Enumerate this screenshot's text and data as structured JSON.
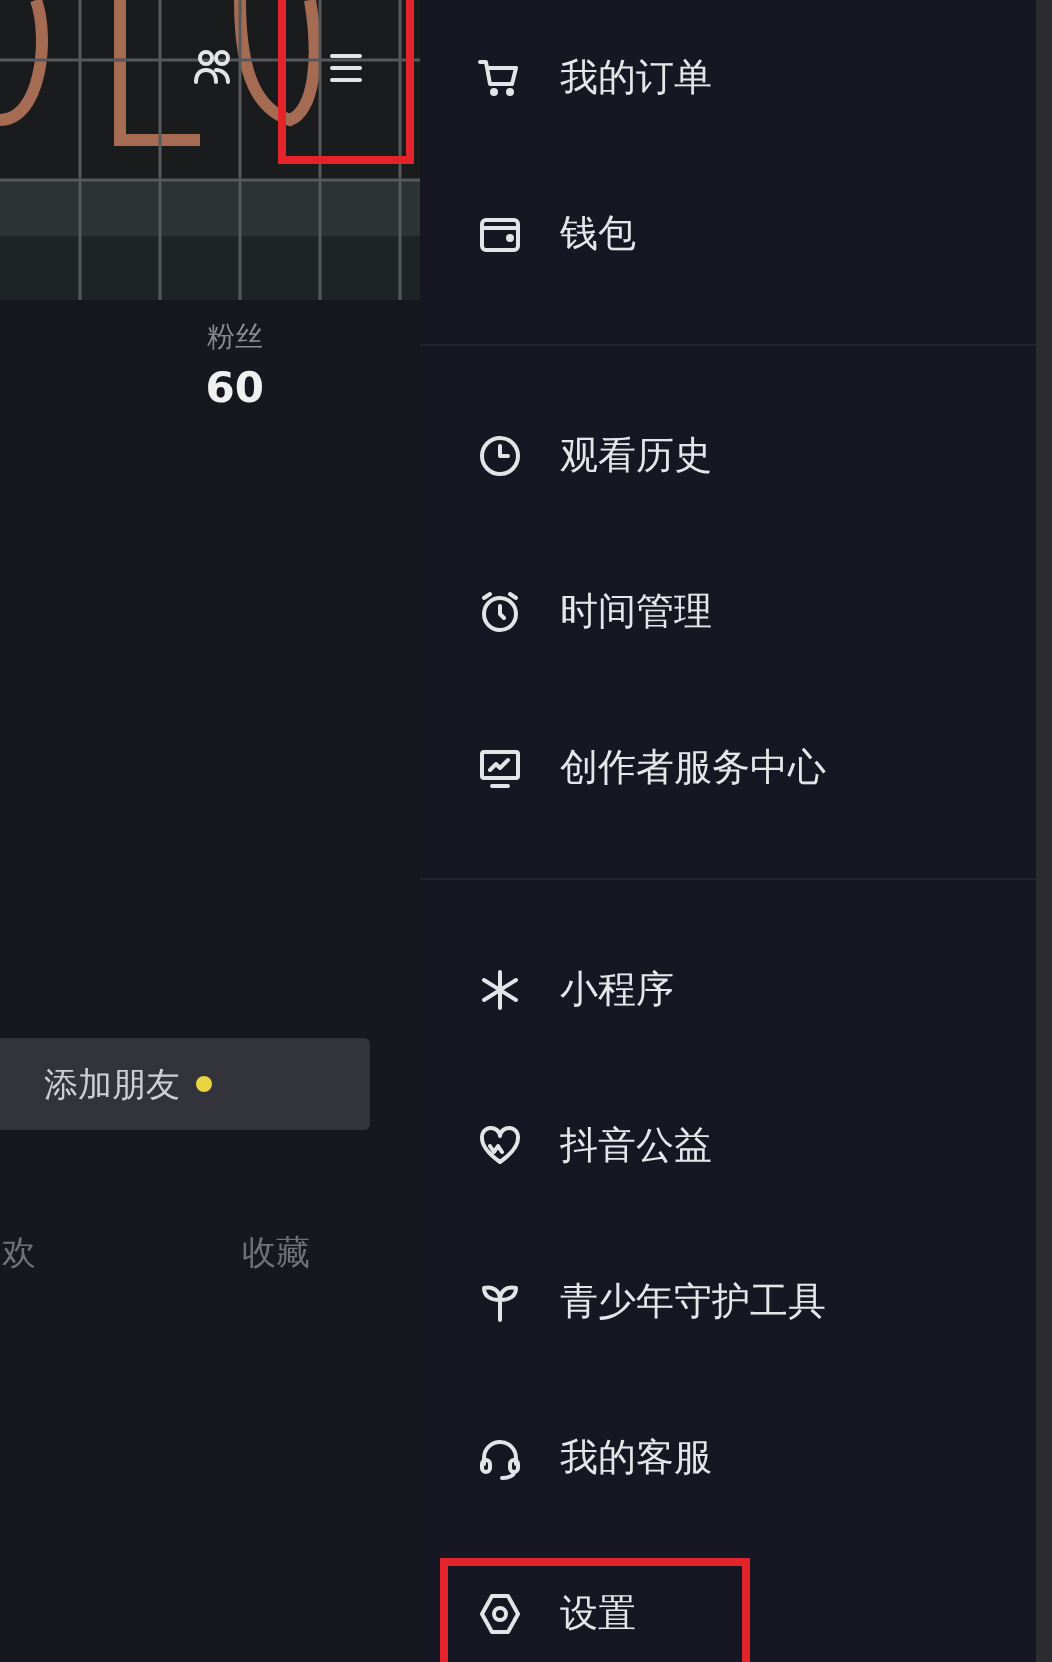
{
  "profile": {
    "header_buttons": [
      {
        "kind": "friends",
        "highlighted": false
      },
      {
        "kind": "menu",
        "highlighted": true
      }
    ],
    "stats": [
      {
        "label": "粉丝",
        "value": "60"
      }
    ],
    "add_friend_button": {
      "label": "添加朋友",
      "notification_dot": true
    },
    "tabs": [
      {
        "label": "欢",
        "selected": false
      },
      {
        "label": "收藏",
        "selected": false
      }
    ]
  },
  "drawer": {
    "sections": [
      {
        "items": [
          {
            "kind": "cart",
            "label": "我的订单",
            "highlighted": false
          },
          {
            "kind": "wallet",
            "label": "钱包",
            "highlighted": false
          }
        ]
      },
      {
        "items": [
          {
            "kind": "clock",
            "label": "观看历史",
            "highlighted": false
          },
          {
            "kind": "alarm",
            "label": "时间管理",
            "highlighted": false
          },
          {
            "kind": "chart",
            "label": "创作者服务中心",
            "highlighted": false
          }
        ]
      },
      {
        "items": [
          {
            "kind": "sparkle",
            "label": "小程序",
            "highlighted": false
          },
          {
            "kind": "heart",
            "label": "抖音公益",
            "highlighted": false
          },
          {
            "kind": "sprout",
            "label": "青少年守护工具",
            "highlighted": false
          },
          {
            "kind": "headset",
            "label": "我的客服",
            "highlighted": false
          },
          {
            "kind": "hexagon",
            "label": "设置",
            "highlighted": true
          }
        ]
      }
    ]
  }
}
